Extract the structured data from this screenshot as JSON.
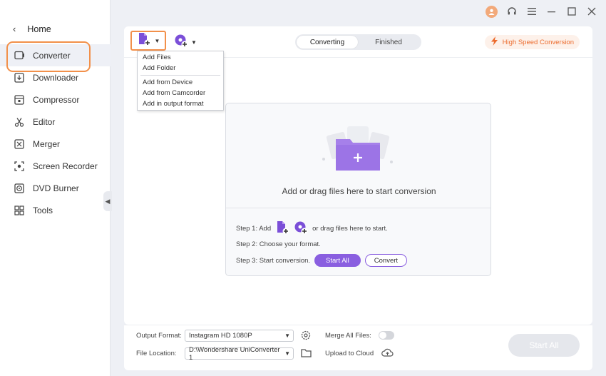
{
  "window": {
    "icons": [
      "user-avatar-icon",
      "headset-icon",
      "hamburger-menu-icon",
      "minimize-icon",
      "maximize-icon",
      "close-icon"
    ]
  },
  "sidebar": {
    "home_label": "Home",
    "items": [
      {
        "label": "Converter",
        "icon": "converter-icon",
        "active": true
      },
      {
        "label": "Downloader",
        "icon": "downloader-icon"
      },
      {
        "label": "Compressor",
        "icon": "compressor-icon"
      },
      {
        "label": "Editor",
        "icon": "scissors-icon"
      },
      {
        "label": "Merger",
        "icon": "merger-icon"
      },
      {
        "label": "Screen Recorder",
        "icon": "screen-recorder-icon"
      },
      {
        "label": "DVD Burner",
        "icon": "dvd-icon"
      },
      {
        "label": "Tools",
        "icon": "tools-grid-icon"
      }
    ]
  },
  "toolbar": {
    "tabs": [
      "Converting",
      "Finished"
    ],
    "high_speed_label": "High Speed Conversion"
  },
  "add_menu": {
    "group1": [
      "Add Files",
      "Add Folder"
    ],
    "group2": [
      "Add from Device",
      "Add from Camcorder",
      "Add in output format"
    ]
  },
  "dropzone": {
    "prompt": "Add or drag files here to start conversion",
    "step1_prefix": "Step 1: Add",
    "step1_suffix": "or drag files here to start.",
    "step2": "Step 2: Choose your format.",
    "step3": "Step 3: Start conversion.",
    "start_all_label": "Start All",
    "convert_label": "Convert"
  },
  "bottom": {
    "output_format_label": "Output Format:",
    "output_format_value": "Instagram HD 1080P",
    "file_location_label": "File Location:",
    "file_location_value": "D:\\Wondershare UniConverter 1",
    "merge_label": "Merge All Files:",
    "upload_label": "Upload to Cloud",
    "start_all_label": "Start All"
  },
  "colors": {
    "accent_purple": "#8a5fe0",
    "highlight_orange": "#f2904a",
    "high_speed_text": "#ec6b2d"
  }
}
